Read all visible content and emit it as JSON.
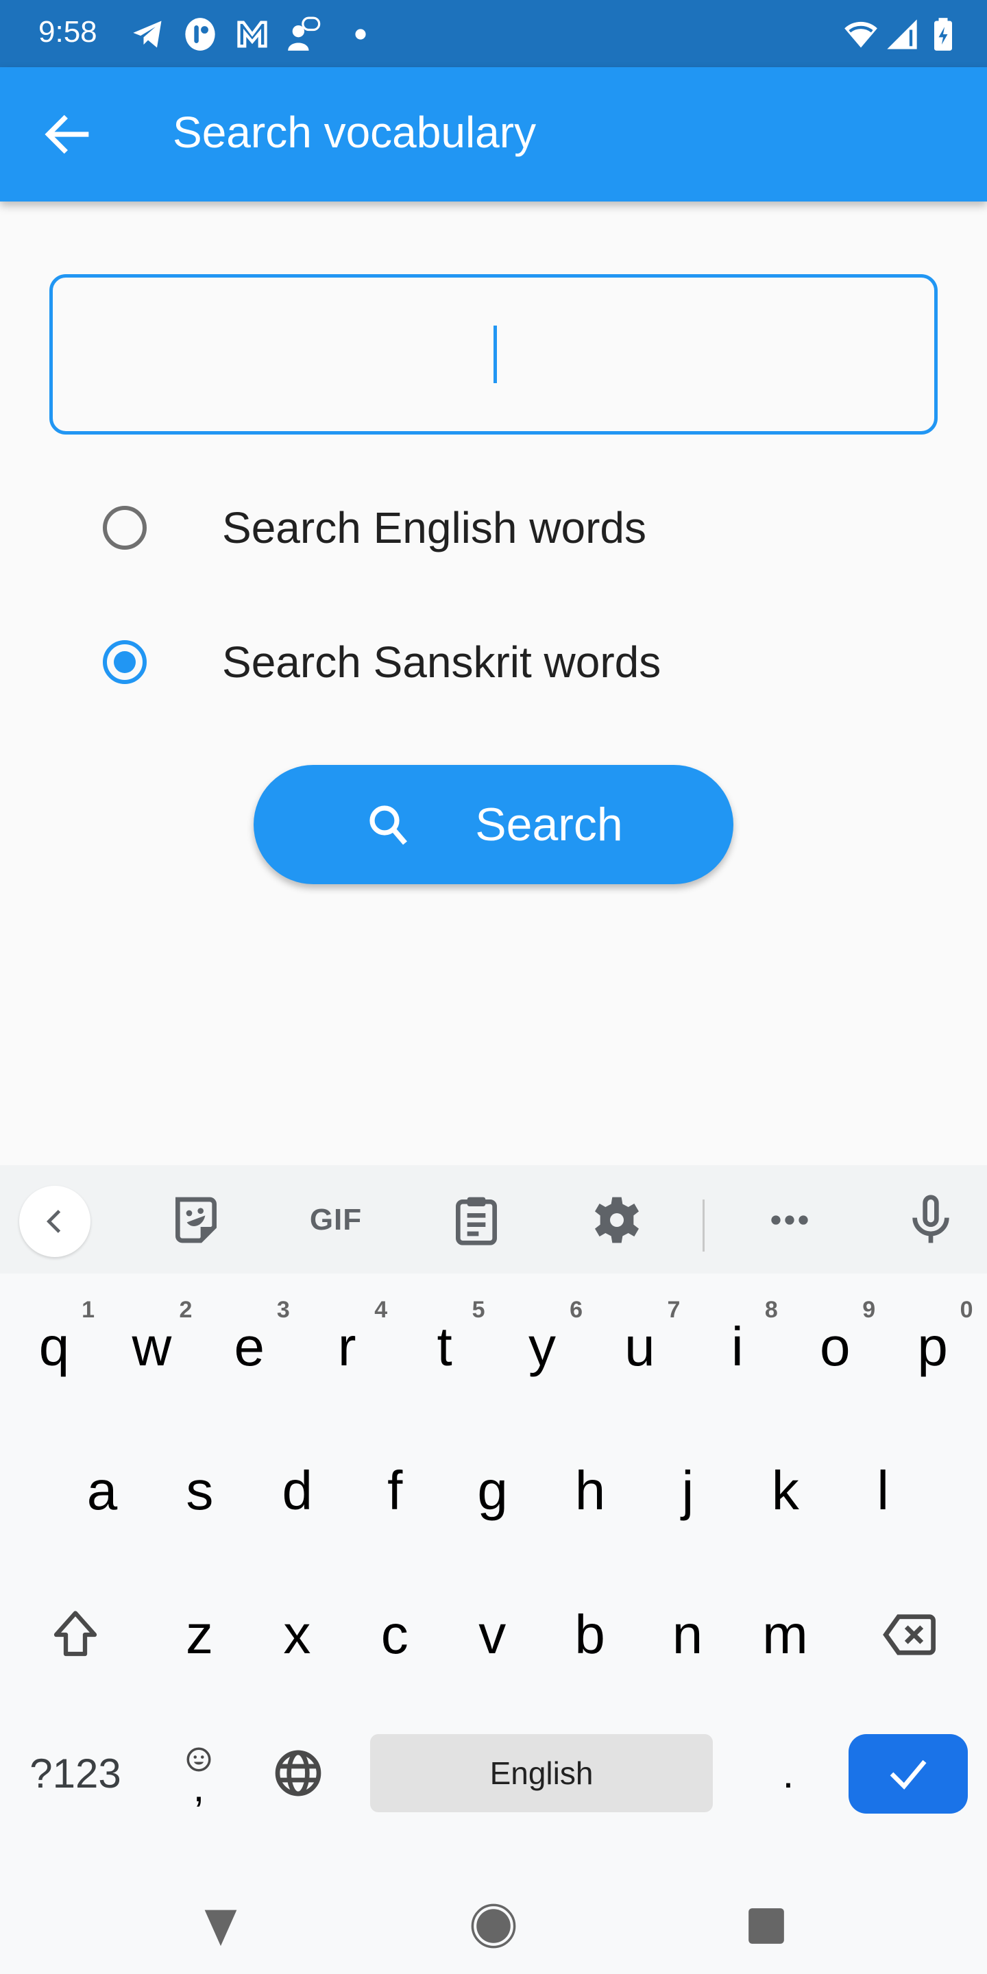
{
  "status_bar": {
    "time": "9:58",
    "notification_icons": [
      "telegram-icon",
      "app-icon",
      "gmail-icon",
      "chat-support-icon",
      "more-dot-icon"
    ],
    "system_icons": [
      "wifi-icon",
      "signal-icon",
      "battery-charging-icon"
    ]
  },
  "app_bar": {
    "title": "Search vocabulary",
    "back_icon": "arrow-back-icon"
  },
  "search": {
    "value": "",
    "placeholder": ""
  },
  "options": [
    {
      "label": "Search English words",
      "selected": false
    },
    {
      "label": "Search Sanskrit words",
      "selected": true
    }
  ],
  "search_button": {
    "label": "Search",
    "icon": "search-icon"
  },
  "colors": {
    "primary": "#2196f3",
    "status_bar": "#1d72bc",
    "enter_key": "#1a73e8"
  },
  "keyboard": {
    "toolbar": [
      "collapse-icon",
      "sticker-icon",
      "GIF",
      "clipboard-icon",
      "settings-icon",
      "more-icon",
      "mic-icon"
    ],
    "gif_label": "GIF",
    "row1": [
      {
        "key": "q",
        "hint": "1"
      },
      {
        "key": "w",
        "hint": "2"
      },
      {
        "key": "e",
        "hint": "3"
      },
      {
        "key": "r",
        "hint": "4"
      },
      {
        "key": "t",
        "hint": "5"
      },
      {
        "key": "y",
        "hint": "6"
      },
      {
        "key": "u",
        "hint": "7"
      },
      {
        "key": "i",
        "hint": "8"
      },
      {
        "key": "o",
        "hint": "9"
      },
      {
        "key": "p",
        "hint": "0"
      }
    ],
    "row2": [
      "a",
      "s",
      "d",
      "f",
      "g",
      "h",
      "j",
      "k",
      "l"
    ],
    "row3": [
      "z",
      "x",
      "c",
      "v",
      "b",
      "n",
      "m"
    ],
    "symbols_label": "?123",
    "comma": ",",
    "space_label": "English",
    "period": "."
  }
}
